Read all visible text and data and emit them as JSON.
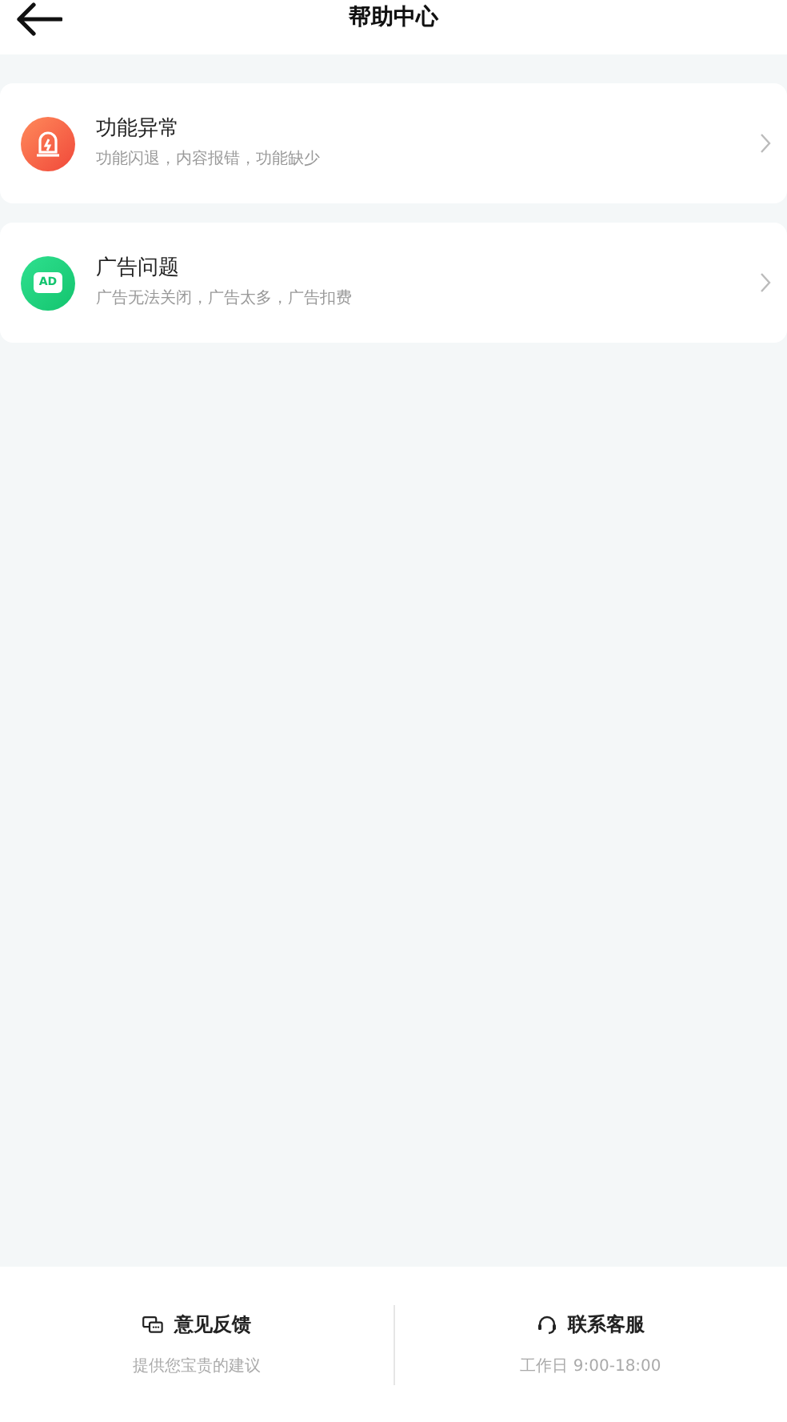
{
  "header": {
    "title": "帮助中心"
  },
  "items": [
    {
      "kind": "alert",
      "title": "功能异常",
      "subtitle": "功能闪退，内容报错，功能缺少"
    },
    {
      "kind": "ad",
      "icon_label": "AD",
      "title": "广告问题",
      "subtitle": "广告无法关闭，广告太多，广告扣费"
    }
  ],
  "footer": [
    {
      "kind": "chat",
      "title": "意见反馈",
      "subtitle": "提供您宝贵的建议"
    },
    {
      "kind": "headset",
      "title": "联系客服",
      "subtitle": "工作日 9:00-18:00"
    }
  ]
}
